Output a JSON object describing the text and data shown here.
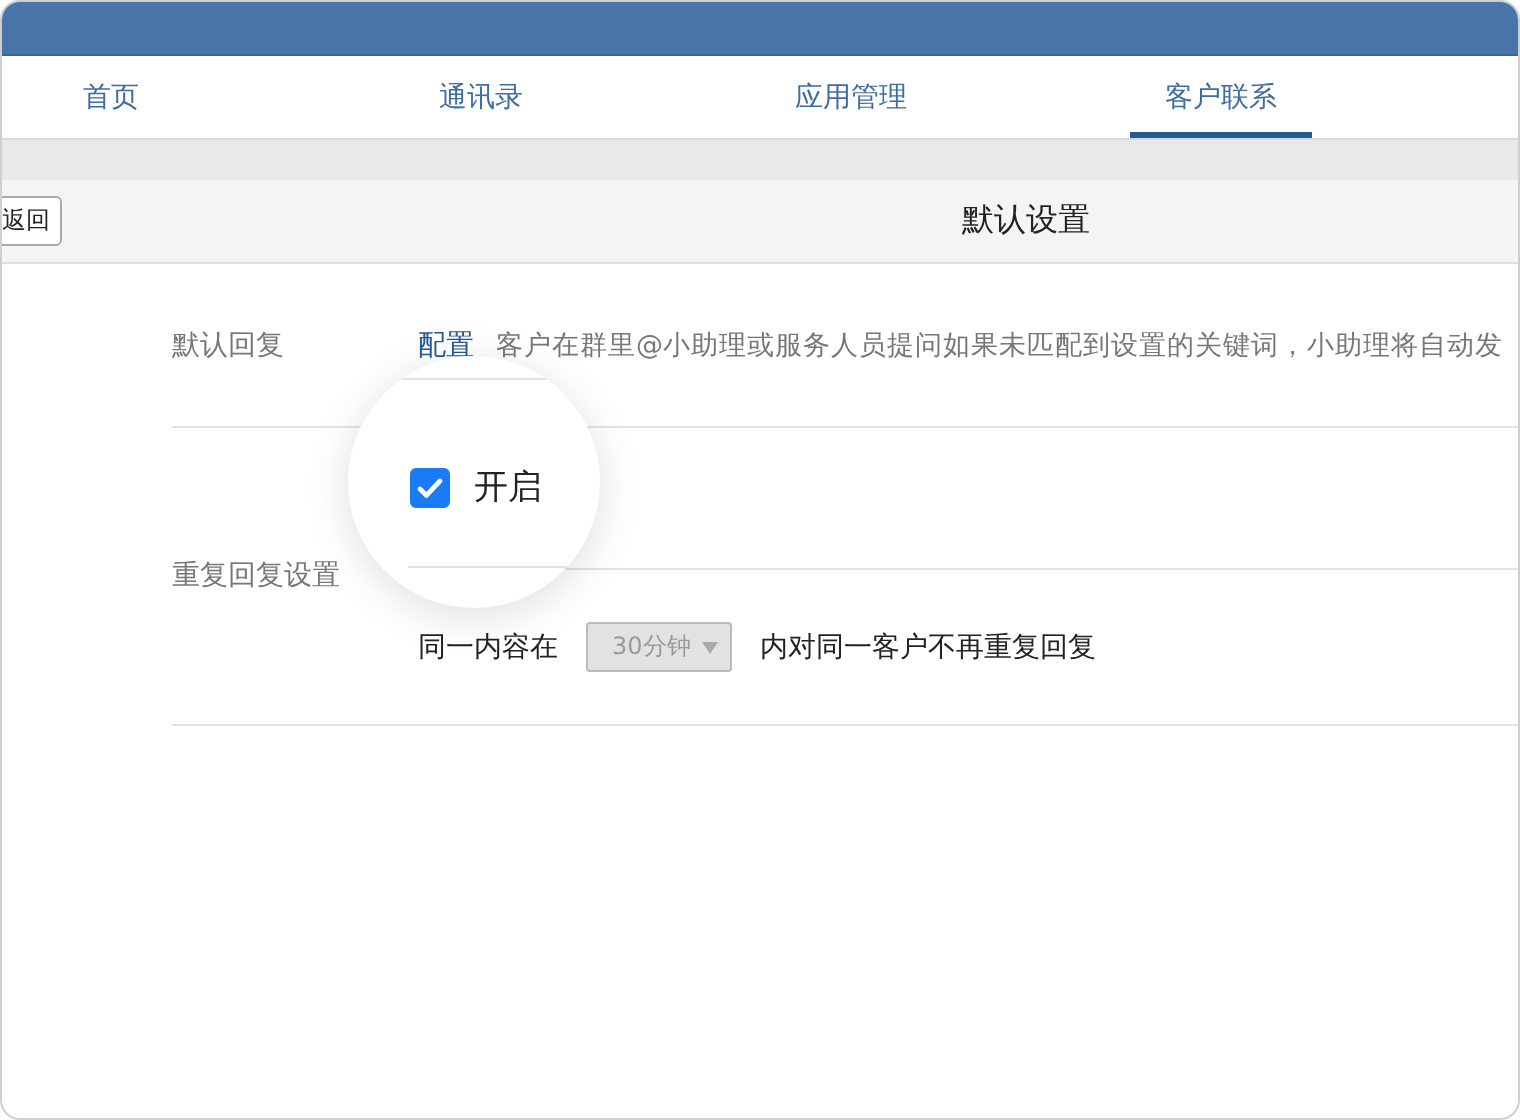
{
  "tabs": [
    {
      "label": "首页",
      "selected": false
    },
    {
      "label": "通讯录",
      "selected": false
    },
    {
      "label": "应用管理",
      "selected": false
    },
    {
      "label": "客户联系",
      "selected": true
    }
  ],
  "header": {
    "back_button": "返回",
    "title": "默认设置"
  },
  "settings": [
    {
      "label": "默认回复",
      "link": "配置",
      "description": "客户在群里@小助理或服务人员提问如果未匹配到设置的关键词，小助理将自动发"
    },
    {
      "label": "重复回复设置",
      "toggle": {
        "label": "开启",
        "checked": true
      },
      "rule": {
        "before": "同一内容在",
        "select": {
          "value": "30分钟",
          "disabled": true
        },
        "after": "内对同一客户不再重复回复"
      }
    }
  ]
}
